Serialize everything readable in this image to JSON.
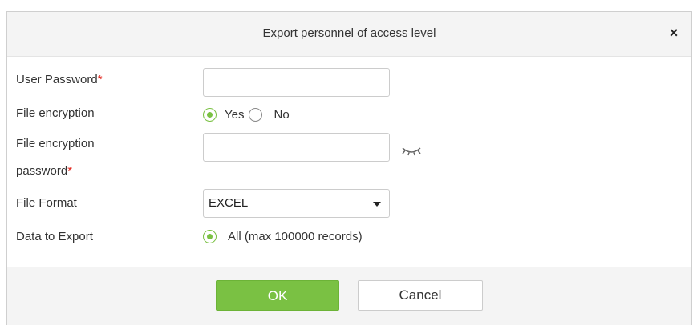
{
  "dialog": {
    "title": "Export personnel of access level",
    "close_label": "×"
  },
  "form": {
    "user_password": {
      "label": "User Password",
      "required_mark": "*",
      "value": ""
    },
    "file_encryption": {
      "label": "File encryption",
      "options": [
        "Yes",
        "No"
      ],
      "selected": "Yes"
    },
    "file_encryption_password": {
      "label_line1": "File encryption",
      "label_line2": "password",
      "required_mark": "*",
      "value": ""
    },
    "file_format": {
      "label": "File Format",
      "selected": "EXCEL"
    },
    "data_to_export": {
      "label": "Data to Export",
      "option": "All (max 100000 records)",
      "selected": true
    }
  },
  "footer": {
    "ok_label": "OK",
    "cancel_label": "Cancel"
  },
  "icons": {
    "close": "close-icon",
    "password_visibility": "eye-closed-icon",
    "select_caret": "chevron-down-icon"
  },
  "colors": {
    "accent": "#7ac143",
    "required": "#e2231a",
    "header_bg": "#f4f4f4"
  }
}
